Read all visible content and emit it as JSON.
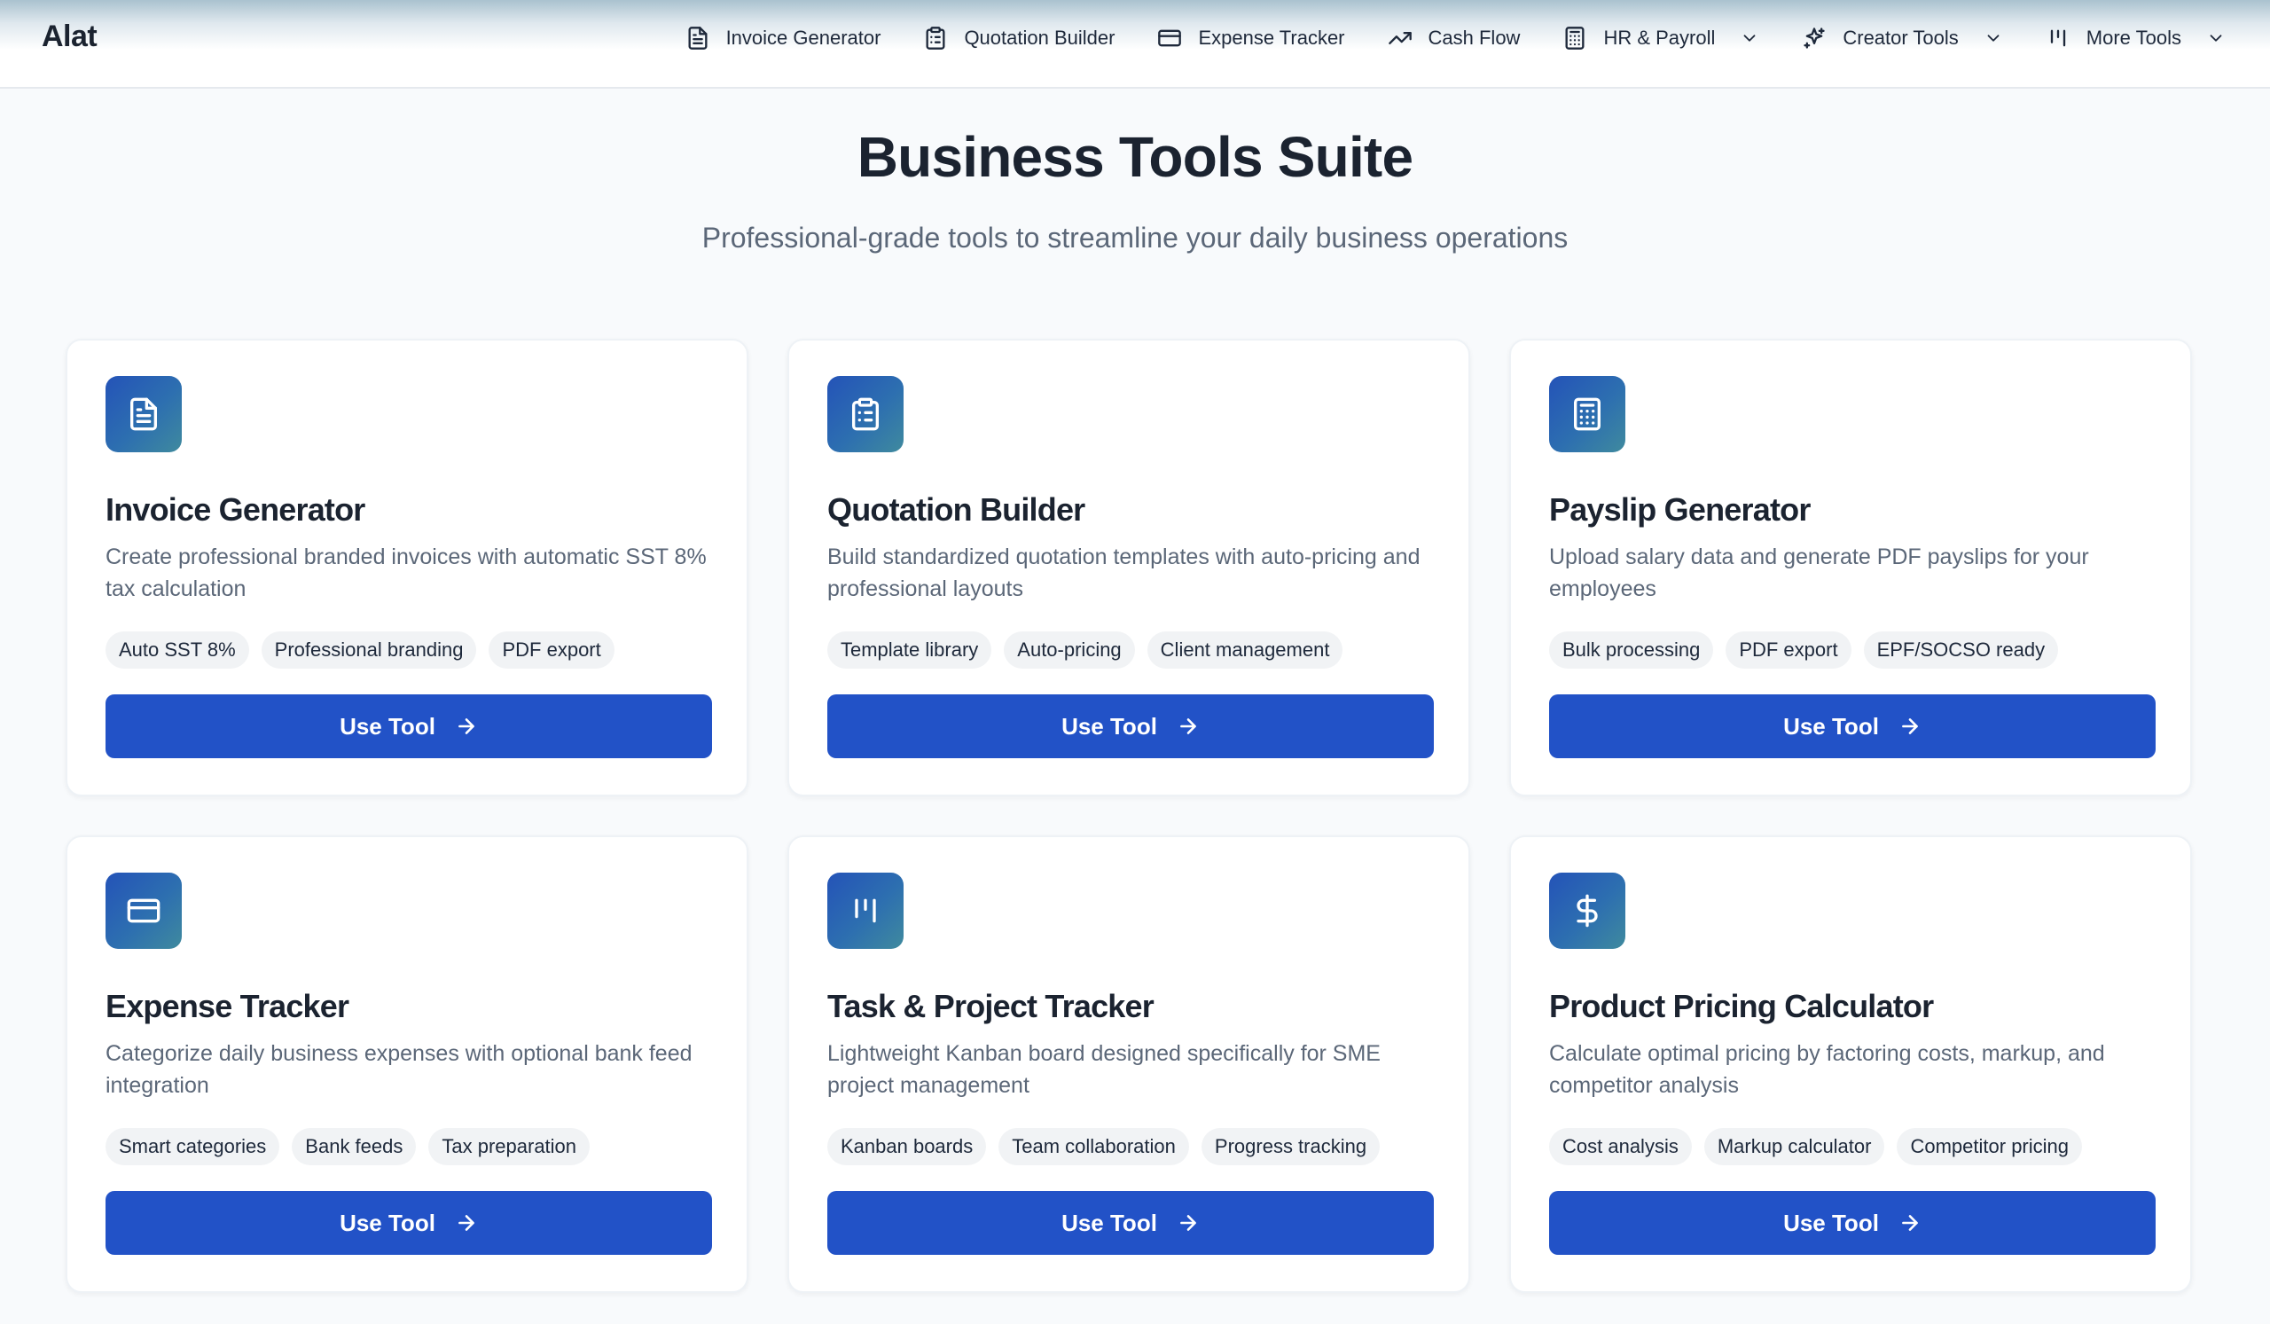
{
  "header": {
    "brand": "Alat",
    "nav": [
      {
        "label": "Invoice Generator",
        "icon": "file-text-icon",
        "dropdown": false
      },
      {
        "label": "Quotation Builder",
        "icon": "clipboard-list-icon",
        "dropdown": false
      },
      {
        "label": "Expense Tracker",
        "icon": "credit-card-icon",
        "dropdown": false
      },
      {
        "label": "Cash Flow",
        "icon": "trending-up-icon",
        "dropdown": false
      },
      {
        "label": "HR & Payroll",
        "icon": "calculator-icon",
        "dropdown": true
      },
      {
        "label": "Creator Tools",
        "icon": "sparkles-icon",
        "dropdown": true
      },
      {
        "label": "More Tools",
        "icon": "kanban-icon",
        "dropdown": true
      }
    ]
  },
  "hero": {
    "title": "Business Tools Suite",
    "subtitle": "Professional-grade tools to streamline your daily business operations"
  },
  "tools": [
    {
      "title": "Invoice Generator",
      "icon": "file-text-icon",
      "description": "Create professional branded invoices with automatic SST 8% tax calculation",
      "tags": [
        "Auto SST 8%",
        "Professional branding",
        "PDF export"
      ],
      "button": "Use Tool"
    },
    {
      "title": "Quotation Builder",
      "icon": "clipboard-list-icon",
      "description": "Build standardized quotation templates with auto-pricing and professional layouts",
      "tags": [
        "Template library",
        "Auto-pricing",
        "Client management"
      ],
      "button": "Use Tool"
    },
    {
      "title": "Payslip Generator",
      "icon": "calculator-icon",
      "description": "Upload salary data and generate PDF payslips for your employees",
      "tags": [
        "Bulk processing",
        "PDF export",
        "EPF/SOCSO ready"
      ],
      "button": "Use Tool"
    },
    {
      "title": "Expense Tracker",
      "icon": "credit-card-icon",
      "description": "Categorize daily business expenses with optional bank feed integration",
      "tags": [
        "Smart categories",
        "Bank feeds",
        "Tax preparation"
      ],
      "button": "Use Tool"
    },
    {
      "title": "Task & Project Tracker",
      "icon": "kanban-icon",
      "description": "Lightweight Kanban board designed specifically for SME project management",
      "tags": [
        "Kanban boards",
        "Team collaboration",
        "Progress tracking"
      ],
      "button": "Use Tool"
    },
    {
      "title": "Product Pricing Calculator",
      "icon": "dollar-sign-icon",
      "description": "Calculate optimal pricing by factoring costs, markup, and competitor analysis",
      "tags": [
        "Cost analysis",
        "Markup calculator",
        "Competitor pricing"
      ],
      "button": "Use Tool"
    }
  ],
  "colors": {
    "primary_button": "#2252c7",
    "icon_gradient_start": "#2453b8",
    "icon_gradient_end": "#3f8a9e",
    "page_background": "#f8fafc"
  }
}
